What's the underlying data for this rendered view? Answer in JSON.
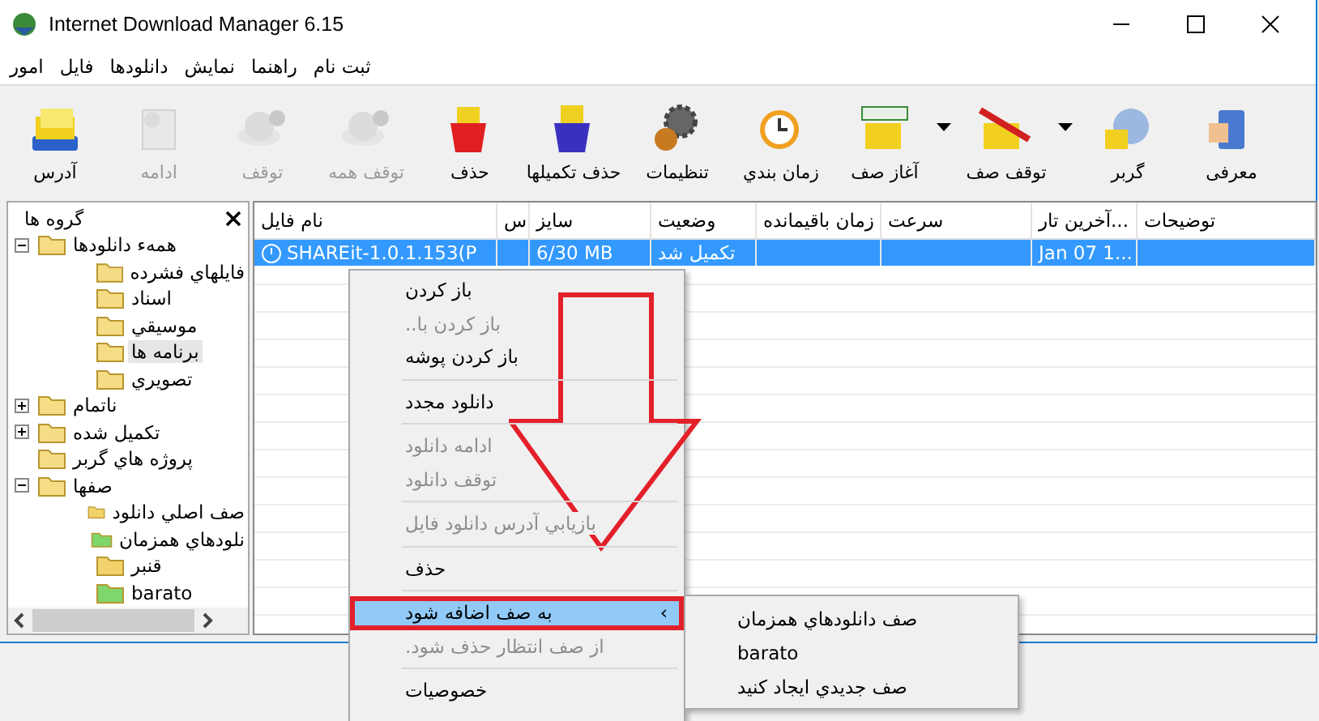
{
  "window": {
    "title": "Internet Download Manager 6.15"
  },
  "menu": [
    "ثبت نام",
    "راهنما",
    "نمايش",
    "دانلودها",
    "فايل",
    "امور"
  ],
  "toolbar": [
    {
      "label": "معرفی",
      "disabled": false,
      "has_menu": false
    },
    {
      "label": "گربر",
      "disabled": false,
      "has_menu": false
    },
    {
      "label": "توقف صف",
      "disabled": false,
      "has_menu": true
    },
    {
      "label": "آغاز صف",
      "disabled": false,
      "has_menu": true
    },
    {
      "label": "زمان بندي",
      "disabled": false,
      "has_menu": false
    },
    {
      "label": "تنظیمات",
      "disabled": false,
      "has_menu": false
    },
    {
      "label": "حذف تکمیلها",
      "disabled": false,
      "has_menu": false
    },
    {
      "label": "حذف",
      "disabled": false,
      "has_menu": false
    },
    {
      "label": "توقف همه",
      "disabled": true,
      "has_menu": false
    },
    {
      "label": "توقف",
      "disabled": true,
      "has_menu": false
    },
    {
      "label": "ادامه",
      "disabled": true,
      "has_menu": false
    },
    {
      "label": "آدرس",
      "disabled": false,
      "has_menu": false
    }
  ],
  "sidebar": {
    "title": "گروه ها",
    "tree": [
      {
        "label": "همهء دانلودها",
        "expanded": true,
        "selected": false,
        "children": [
          {
            "label": "فايلهاي فشرده",
            "selected": false
          },
          {
            "label": "اسناد",
            "selected": false
          },
          {
            "label": "موسيقي",
            "selected": false
          },
          {
            "label": "برنامه ها",
            "selected": true
          },
          {
            "label": "تصويري",
            "selected": false
          }
        ]
      },
      {
        "label": "ناتمام",
        "expanded": false,
        "selected": false
      },
      {
        "label": "تكميل شده",
        "expanded": false,
        "selected": false
      },
      {
        "label": "پروژه هاي گربر",
        "selected": false
      },
      {
        "label": "صفها",
        "expanded": true,
        "selected": false,
        "children": [
          {
            "label": "صف اصلي دانلود",
            "selected": false,
            "color": "#f2d36b"
          },
          {
            "label": "نلودهاي همزمان",
            "selected": false,
            "color": "#7fd66b"
          },
          {
            "label": "قنبر",
            "selected": false,
            "color": "#f2d36b"
          },
          {
            "label": "barato",
            "selected": false,
            "color": "#7fd66b"
          }
        ]
      }
    ]
  },
  "table": {
    "columns": [
      "توضيحات",
      "آخرين تار...",
      "سرعت",
      "زمان باقيمانده",
      "وضعيت",
      "سايز",
      "س",
      "نام فايل"
    ],
    "rows": [
      {
        "selected": true,
        "last_try": "Jan 07 1...",
        "status": "تكميل شد",
        "size": "6/30 MB",
        "file_name": "SHAREit-1.0.1.153(P"
      }
    ]
  },
  "context_menu": {
    "items": [
      {
        "kind": "item",
        "label": "باز کردن",
        "disabled": false
      },
      {
        "kind": "item",
        "label": "باز کردن با..",
        "disabled": true
      },
      {
        "kind": "item",
        "label": "باز کردن پوشه",
        "disabled": false
      },
      {
        "kind": "separator"
      },
      {
        "kind": "item",
        "label": "دانلود مجدد",
        "disabled": false
      },
      {
        "kind": "separator"
      },
      {
        "kind": "item",
        "label": "ادامه دانلود",
        "disabled": true
      },
      {
        "kind": "item",
        "label": "توقف دانلود",
        "disabled": true
      },
      {
        "kind": "separator"
      },
      {
        "kind": "item",
        "label": "بازيابي آدرس دانلود فايل",
        "disabled": true
      },
      {
        "kind": "separator"
      },
      {
        "kind": "item",
        "label": "حذف",
        "disabled": false
      },
      {
        "kind": "separator"
      },
      {
        "kind": "submenu",
        "label": "به صف اضافه شود",
        "disabled": false,
        "selected": true,
        "chevron": "‹"
      },
      {
        "kind": "item",
        "label": "از صف انتظار حذف شود.",
        "disabled": true
      },
      {
        "kind": "separator"
      },
      {
        "kind": "item",
        "label": "خصوصيات",
        "disabled": false
      }
    ]
  },
  "submenu": {
    "items": [
      "صف دانلودهاي همزمان",
      "barato",
      "صف جديدي ايجاد کنيد"
    ]
  }
}
